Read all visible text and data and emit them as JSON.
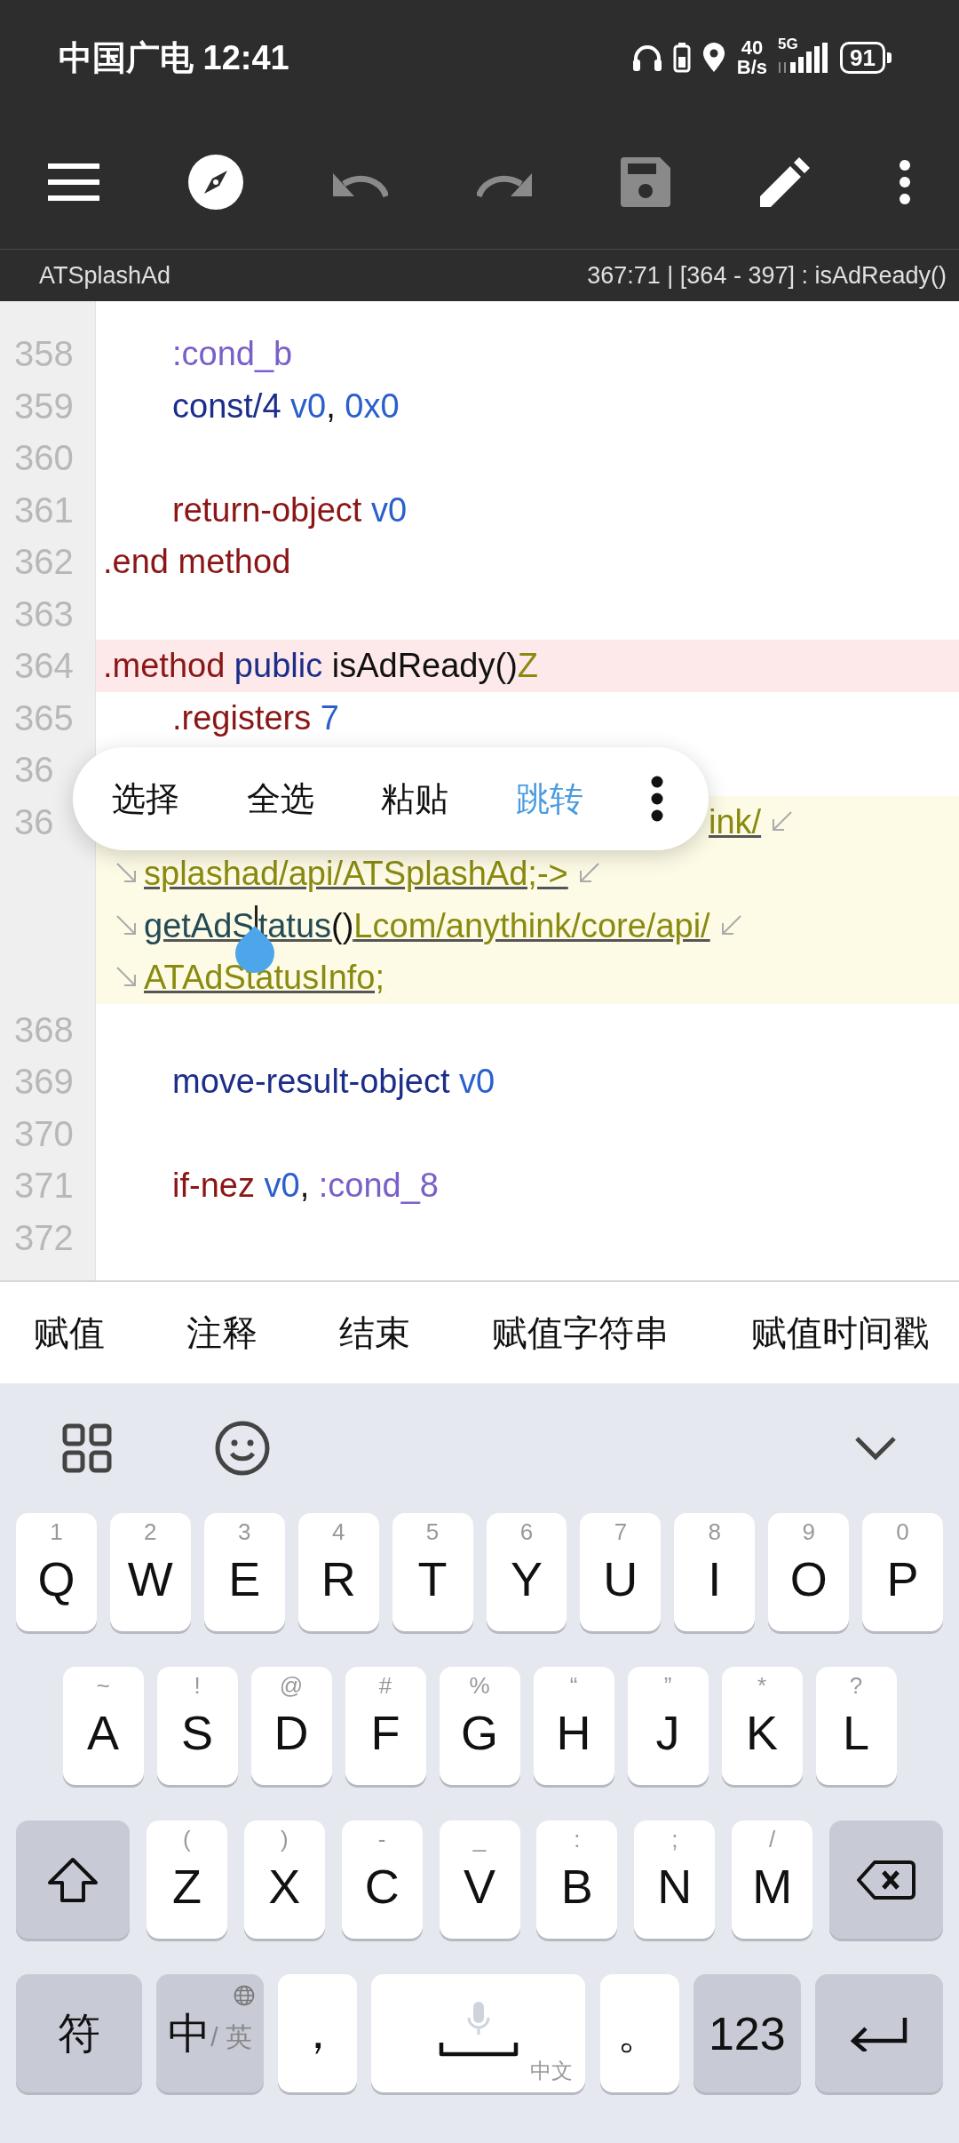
{
  "status_bar": {
    "carrier_time": "中国广电 12:41",
    "net_speed": "40",
    "net_unit": "B/s",
    "network": "5G",
    "battery": "91"
  },
  "toolbar": [
    {
      "kind": "menu",
      "disabled": false
    },
    {
      "kind": "compass",
      "disabled": false
    },
    {
      "kind": "undo",
      "disabled": true
    },
    {
      "kind": "redo",
      "disabled": true
    },
    {
      "kind": "save",
      "disabled": true
    },
    {
      "kind": "edit",
      "disabled": false
    },
    {
      "kind": "more",
      "disabled": false
    }
  ],
  "info_bar": {
    "file": "ATSplashAd",
    "position": "367:71 | [364 - 397] : isAdReady()"
  },
  "code_lines": [
    {
      "number": "358",
      "kind": "plain",
      "indented": true,
      "tokens": [
        {
          "text": ":cond_b",
          "kind": "label"
        }
      ]
    },
    {
      "number": "359",
      "kind": "plain",
      "indented": true,
      "tokens": [
        {
          "text": "const/4",
          "kind": "op"
        },
        {
          "text": " v0",
          "kind": "reg"
        },
        {
          "text": ",",
          "kind": "punct"
        },
        {
          "text": " 0x0",
          "kind": "num"
        }
      ]
    },
    {
      "number": "360",
      "kind": "plain"
    },
    {
      "number": "361",
      "kind": "plain",
      "indented": true,
      "tokens": [
        {
          "text": "return-object",
          "kind": "flow"
        },
        {
          "text": " v0",
          "kind": "reg"
        }
      ]
    },
    {
      "number": "362",
      "kind": "plain",
      "indented": false,
      "tokens": [
        {
          "text": ".end method",
          "kind": "flow"
        }
      ]
    },
    {
      "number": "363",
      "kind": "plain"
    },
    {
      "number": "364",
      "kind": "marked",
      "indented": false,
      "tokens": [
        {
          "text": ".method",
          "kind": "flow"
        },
        {
          "text": " public",
          "kind": "op"
        },
        {
          "text": " isAdReady()",
          "kind": "name"
        },
        {
          "text": "Z",
          "kind": "type"
        }
      ]
    },
    {
      "number": "365",
      "kind": "plain",
      "indented": true,
      "tokens": [
        {
          "text": ".registers",
          "kind": "flow"
        },
        {
          "text": " 7",
          "kind": "num"
        }
      ]
    },
    {
      "number": "36",
      "kind": "plain"
    },
    {
      "number": "36",
      "kind": "current",
      "rows": [
        {
          "covered": true,
          "underlined": true,
          "tokens": [
            {
              "text": "ink/",
              "kind": "type",
              "caret": false
            }
          ]
        },
        {
          "covered": false,
          "underlined": true,
          "tokens": [
            {
              "text": "splashad/api/ATSplashAd;->",
              "kind": "type",
              "caret": false
            }
          ]
        },
        {
          "covered": false,
          "underlined": true,
          "tokens": [
            {
              "text": "getAdS",
              "kind": "method",
              "caret": false
            },
            {
              "text": "tatus",
              "kind": "method",
              "caret": true
            },
            {
              "text": "()",
              "kind": "name",
              "caret": false
            },
            {
              "text": "Lcom/anythink/core/api/",
              "kind": "type",
              "caret": false
            }
          ]
        },
        {
          "covered": false,
          "underlined": true,
          "tokens": [
            {
              "text": "ATAdStatusInfo;",
              "kind": "type",
              "caret": false
            }
          ]
        }
      ]
    },
    {
      "number": "368",
      "kind": "plain"
    },
    {
      "number": "369",
      "kind": "plain",
      "indented": true,
      "tokens": [
        {
          "text": "move-result-object",
          "kind": "op"
        },
        {
          "text": " v0",
          "kind": "reg"
        }
      ]
    },
    {
      "number": "370",
      "kind": "plain"
    },
    {
      "number": "371",
      "kind": "plain",
      "indented": true,
      "tokens": [
        {
          "text": "if-nez",
          "kind": "flow"
        },
        {
          "text": " v0",
          "kind": "reg"
        },
        {
          "text": ",",
          "kind": "punct"
        },
        {
          "text": " :cond_8",
          "kind": "label"
        }
      ]
    },
    {
      "number": "372",
      "kind": "plain"
    }
  ],
  "context_menu": {
    "items": [
      {
        "label": "选择",
        "selected": false
      },
      {
        "label": "全选",
        "selected": false
      },
      {
        "label": "粘贴",
        "selected": false
      },
      {
        "label": "跳转",
        "selected": true
      }
    ]
  },
  "suggestions": [
    "赋值",
    "注释",
    "结束",
    "赋值字符串",
    "赋值时间戳"
  ],
  "keyboard": {
    "toolbar": [
      {
        "kind": "grid"
      },
      {
        "kind": "emoji"
      },
      {
        "kind": "collapse"
      }
    ],
    "key_rows": [
      {
        "keys": [
          {
            "kind": "letter",
            "label": "Q",
            "hint": "1"
          },
          {
            "kind": "letter",
            "label": "W",
            "hint": "2"
          },
          {
            "kind": "letter",
            "label": "E",
            "hint": "3"
          },
          {
            "kind": "letter",
            "label": "R",
            "hint": "4"
          },
          {
            "kind": "letter",
            "label": "T",
            "hint": "5"
          },
          {
            "kind": "letter",
            "label": "Y",
            "hint": "6"
          },
          {
            "kind": "letter",
            "label": "U",
            "hint": "7"
          },
          {
            "kind": "letter",
            "label": "I",
            "hint": "8"
          },
          {
            "kind": "letter",
            "label": "O",
            "hint": "9"
          },
          {
            "kind": "letter",
            "label": "P",
            "hint": "0"
          }
        ]
      },
      {
        "keys": [
          {
            "kind": "letter",
            "label": "A",
            "hint": "~"
          },
          {
            "kind": "letter",
            "label": "S",
            "hint": "!"
          },
          {
            "kind": "letter",
            "label": "D",
            "hint": "@"
          },
          {
            "kind": "letter",
            "label": "F",
            "hint": "#"
          },
          {
            "kind": "letter",
            "label": "G",
            "hint": "%"
          },
          {
            "kind": "letter",
            "label": "H",
            "hint": "“"
          },
          {
            "kind": "letter",
            "label": "J",
            "hint": "”"
          },
          {
            "kind": "letter",
            "label": "K",
            "hint": "*"
          },
          {
            "kind": "letter",
            "label": "L",
            "hint": "?"
          }
        ]
      },
      {
        "keys": [
          {
            "kind": "shift"
          },
          {
            "kind": "letter",
            "label": "Z",
            "hint": "("
          },
          {
            "kind": "letter",
            "label": "X",
            "hint": ")"
          },
          {
            "kind": "letter",
            "label": "C",
            "hint": "-"
          },
          {
            "kind": "letter",
            "label": "V",
            "hint": "_"
          },
          {
            "kind": "letter",
            "label": "B",
            "hint": ":"
          },
          {
            "kind": "letter",
            "label": "N",
            "hint": ";"
          },
          {
            "kind": "letter",
            "label": "M",
            "hint": "/"
          },
          {
            "kind": "backspace"
          }
        ]
      },
      {
        "keys": [
          {
            "kind": "symbols",
            "label": "符"
          },
          {
            "kind": "lang",
            "label": "中",
            "hint": "/ 英"
          },
          {
            "kind": "punct",
            "label": "，"
          },
          {
            "kind": "space",
            "hint": "中文"
          },
          {
            "kind": "punct",
            "label": "。"
          },
          {
            "kind": "numbers",
            "label": "123"
          },
          {
            "kind": "enter"
          }
        ]
      }
    ]
  }
}
